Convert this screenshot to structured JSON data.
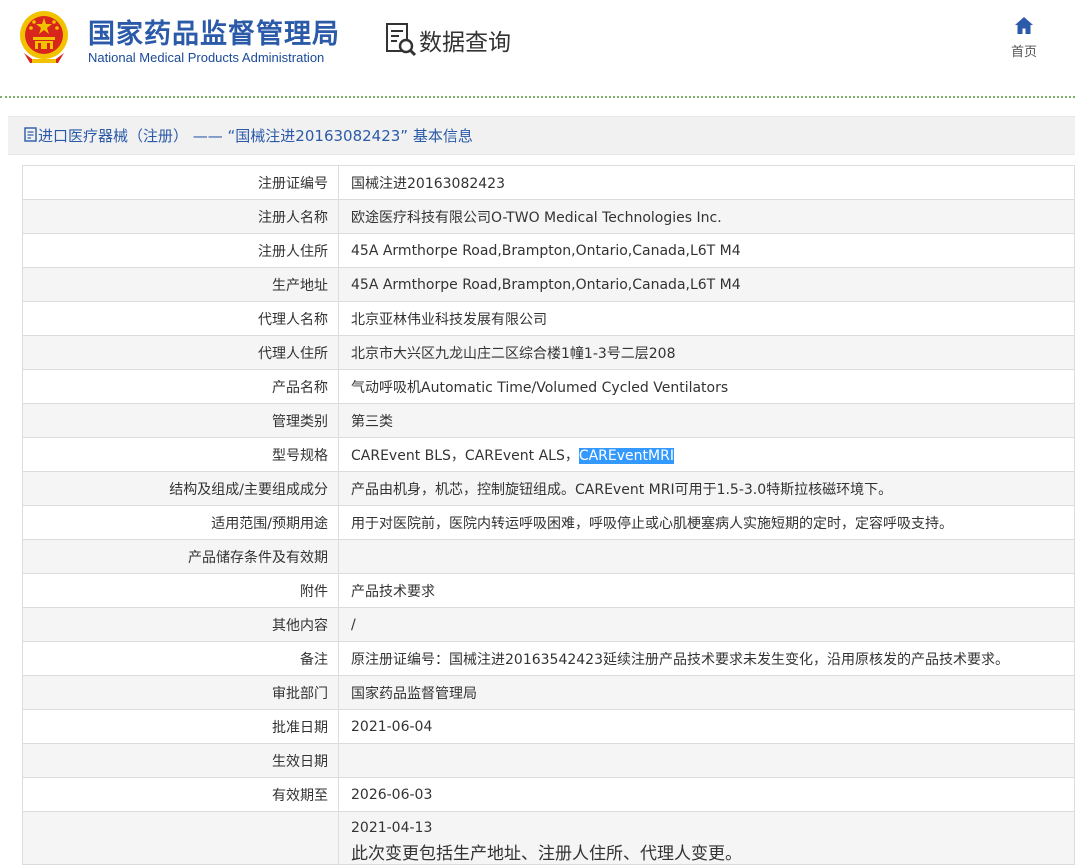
{
  "header": {
    "org_name_cn": "国家药品监督管理局",
    "org_name_en": "National Medical Products Administration",
    "data_query": "数据查询",
    "home_label": "首页"
  },
  "section": {
    "title": "进口医疗器械（注册） —— “国械注进20163082423” 基本信息"
  },
  "rows": [
    {
      "label": "注册证编号",
      "value": "国械注进20163082423"
    },
    {
      "label": "注册人名称",
      "value": "欧途医疗科技有限公司O-TWO Medical Technologies Inc."
    },
    {
      "label": "注册人住所",
      "value": "45A Armthorpe Road,Brampton,Ontario,Canada,L6T M4"
    },
    {
      "label": "生产地址",
      "value": "45A Armthorpe Road,Brampton,Ontario,Canada,L6T M4"
    },
    {
      "label": "代理人名称",
      "value": "北京亚林伟业科技发展有限公司"
    },
    {
      "label": "代理人住所",
      "value": "北京市大兴区九龙山庄二区综合楼1幢1-3号二层208"
    },
    {
      "label": "产品名称",
      "value": "气动呼吸机Automatic Time/Volumed Cycled Ventilators"
    },
    {
      "label": "管理类别",
      "value": "第三类"
    },
    {
      "label": "型号规格",
      "value_plain": "CAREvent BLS，CAREvent ALS，",
      "value_selected": "CAREventMRI"
    },
    {
      "label": "结构及组成/主要组成成分",
      "value": "产品由机身，机芯，控制旋钮组成。CAREvent MRI可用于1.5-3.0特斯拉核磁环境下。"
    },
    {
      "label": "适用范围/预期用途",
      "value": "用于对医院前，医院内转运呼吸困难，呼吸停止或心肌梗塞病人实施短期的定时，定容呼吸支持。"
    },
    {
      "label": "产品储存条件及有效期",
      "value": ""
    },
    {
      "label": "附件",
      "value": "产品技术要求"
    },
    {
      "label": "其他内容",
      "value": "/"
    },
    {
      "label": "备注",
      "value": "原注册证编号：国械注进20163542423延续注册产品技术要求未发生变化，沿用原核发的产品技术要求。"
    },
    {
      "label": "审批部门",
      "value": "国家药品监督管理局"
    },
    {
      "label": "批准日期",
      "value": "2021-06-04"
    },
    {
      "label": "生效日期",
      "value": ""
    },
    {
      "label": "有效期至",
      "value": "2026-06-03"
    },
    {
      "label": "",
      "date": "2021-04-13",
      "note": "此次变更包括生产地址、注册人住所、代理人变更。"
    }
  ],
  "colors": {
    "brand_blue": "#2b5aa8",
    "selection": "#3399ff",
    "emblem_red": "#d8261c",
    "emblem_gold": "#f2c200"
  },
  "icons": {
    "emblem": "national-emblem-icon",
    "query": "document-search-icon",
    "home": "home-icon",
    "section": "document-icon"
  }
}
